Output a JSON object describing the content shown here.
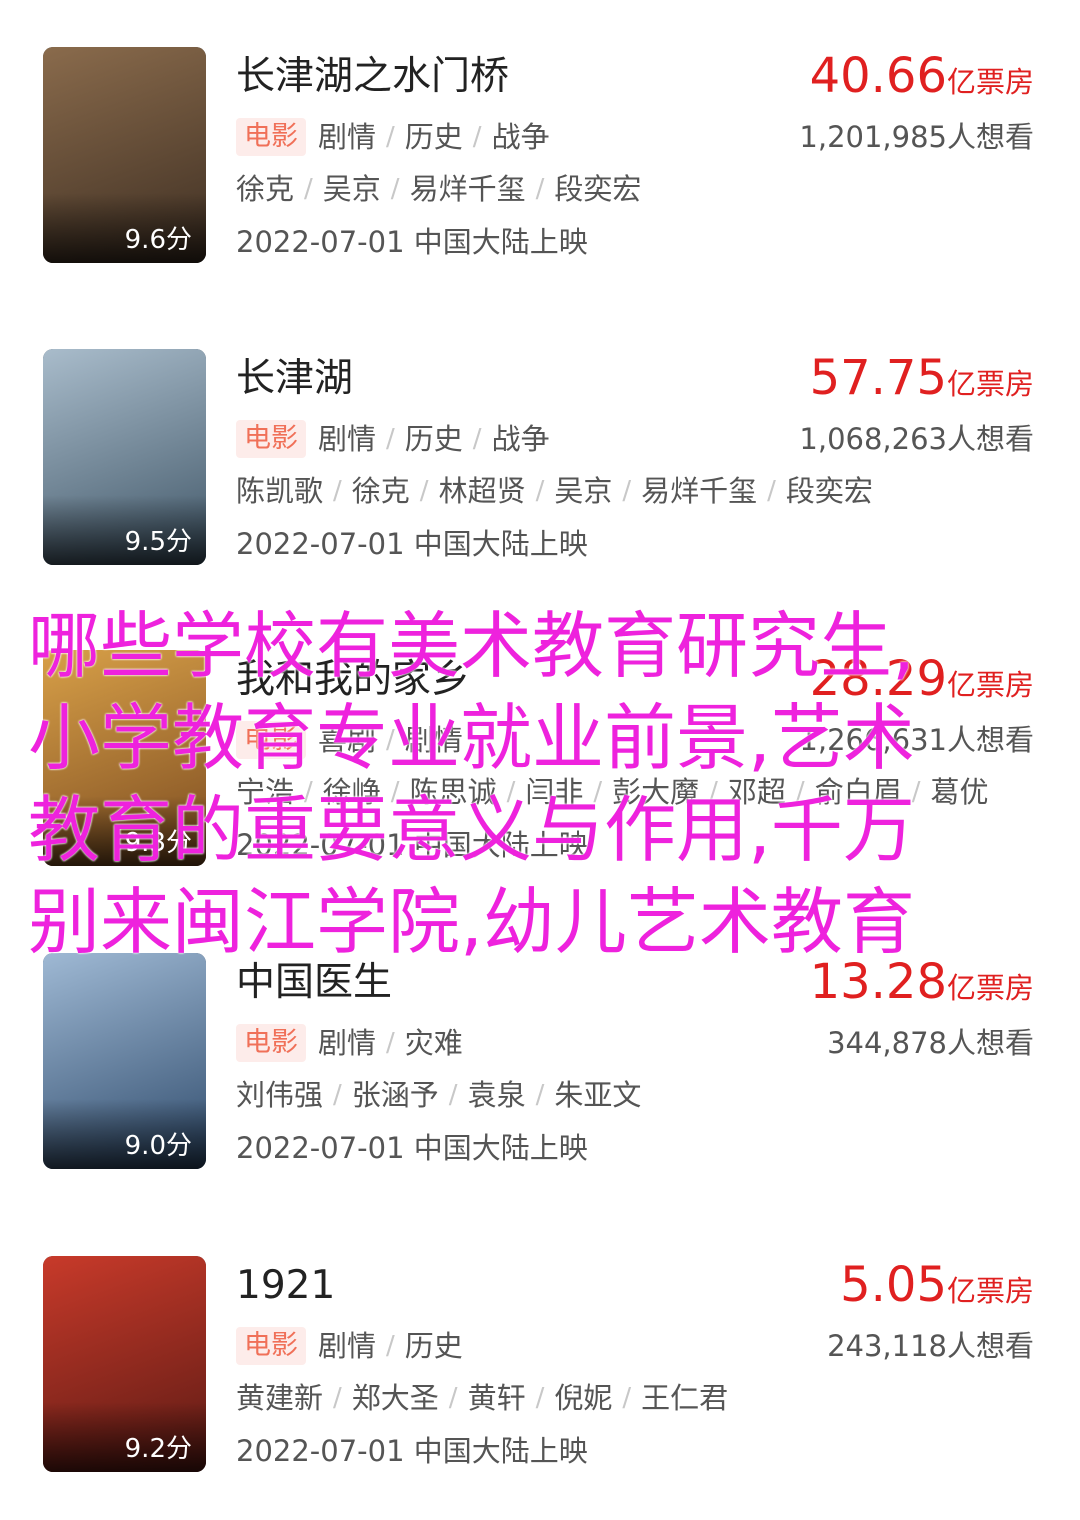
{
  "movies": [
    {
      "title": "长津湖之水门桥",
      "box_number": "40.66",
      "box_unit": "亿票房",
      "tag": "电影",
      "genres": [
        "剧情",
        "历史",
        "战争"
      ],
      "wants": "1,201,985人想看",
      "cast": [
        "徐克",
        "吴京",
        "易烊千玺",
        "段奕宏"
      ],
      "release": "2022-07-01 中国大陆上映",
      "score": "9.6分",
      "poster_colors": [
        "#8a6b4c",
        "#3d2e22"
      ]
    },
    {
      "title": "长津湖",
      "box_number": "57.75",
      "box_unit": "亿票房",
      "tag": "电影",
      "genres": [
        "剧情",
        "历史",
        "战争"
      ],
      "wants": "1,068,263人想看",
      "cast": [
        "陈凯歌",
        "徐克",
        "林超贤",
        "吴京",
        "易烊千玺",
        "段奕宏"
      ],
      "release": "2022-07-01 中国大陆上映",
      "score": "9.5分",
      "poster_colors": [
        "#a9bccb",
        "#3f5566"
      ]
    },
    {
      "title": "我和我的家乡",
      "box_number": "28.29",
      "box_unit": "亿票房",
      "tag": "电影",
      "genres": [
        "喜剧",
        "剧情"
      ],
      "wants": "1,266,631人想看",
      "cast": [
        "宁浩",
        "徐峥",
        "陈思诚",
        "闫非",
        "彭大魔",
        "邓超",
        "俞白眉",
        "葛优"
      ],
      "release": "2022-07-01 中国大陆上映",
      "score": "9.3分",
      "poster_colors": [
        "#d8a048",
        "#7a4a20"
      ]
    },
    {
      "title": "中国医生",
      "box_number": "13.28",
      "box_unit": "亿票房",
      "tag": "电影",
      "genres": [
        "剧情",
        "灾难"
      ],
      "wants": "344,878人想看",
      "cast": [
        "刘伟强",
        "张涵予",
        "袁泉",
        "朱亚文"
      ],
      "release": "2022-07-01 中国大陆上映",
      "score": "9.0分",
      "poster_colors": [
        "#9fb9d4",
        "#2e4a6b"
      ]
    },
    {
      "title": "1921",
      "box_number": "5.05",
      "box_unit": "亿票房",
      "tag": "电影",
      "genres": [
        "剧情",
        "历史"
      ],
      "wants": "243,118人想看",
      "cast": [
        "黄建新",
        "郑大圣",
        "黄轩",
        "倪妮",
        "王仁君"
      ],
      "release": "2022-07-01 中国大陆上映",
      "score": "9.2分",
      "poster_colors": [
        "#c83a2a",
        "#5a1a14"
      ]
    }
  ],
  "overlay_lines": [
    "哪些学校有美术教育研究生,",
    "小学教育专业就业前景,艺术",
    "教育的重要意义与作用,千万",
    "别来闽江学院,幼儿艺术教育"
  ],
  "colors": {
    "box_office": "#e02020",
    "tag_text": "#f07058",
    "tag_bg": "#fdecea",
    "overlay_text": "#ee22dd"
  }
}
